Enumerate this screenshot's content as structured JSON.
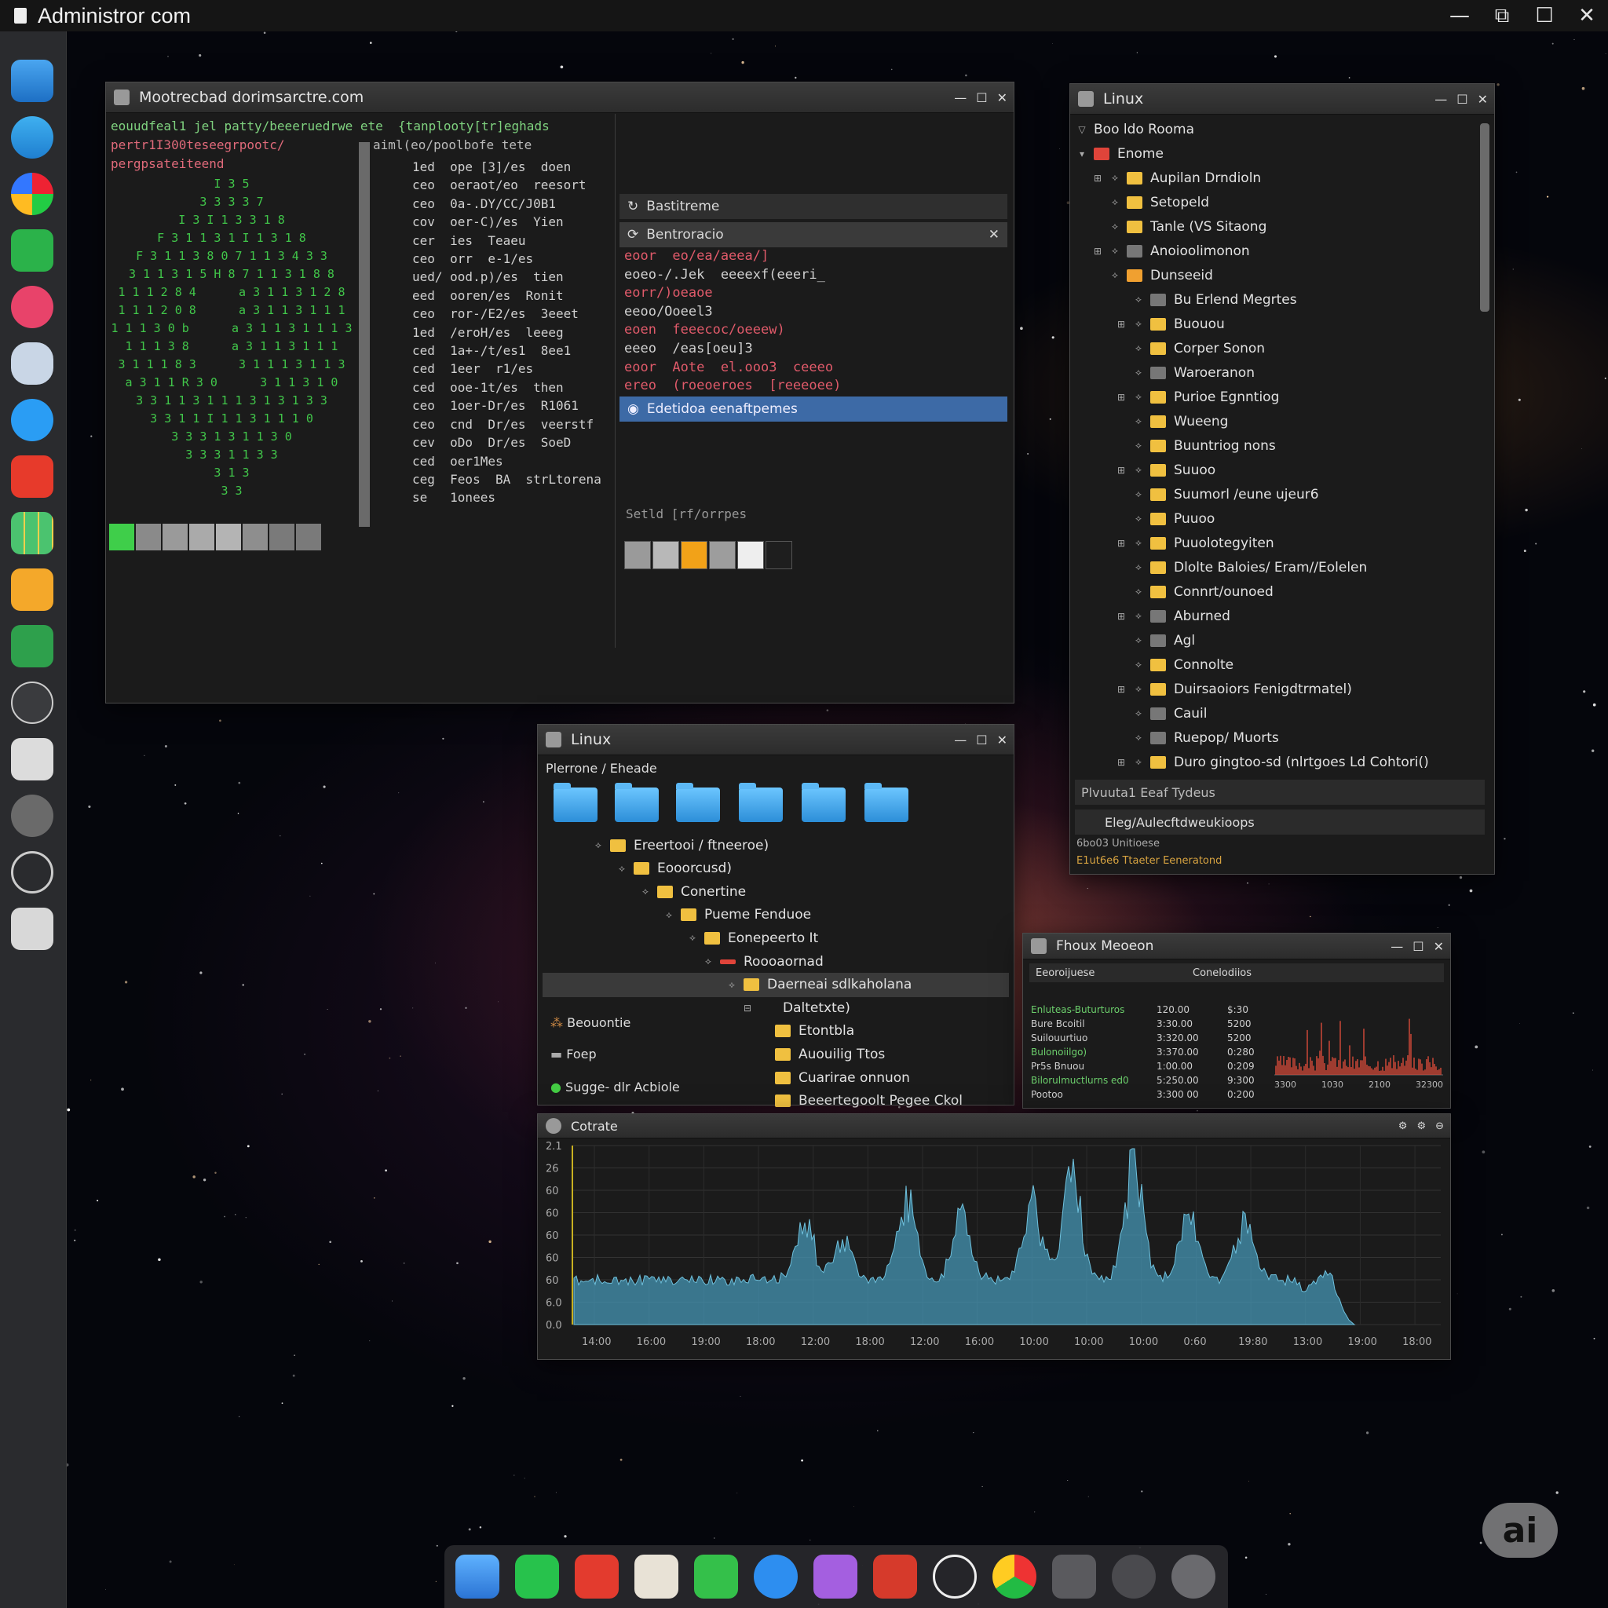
{
  "app": {
    "title": "Administror com"
  },
  "window_controls": {
    "minimize": "—",
    "restore": "⧉",
    "maximize": "☐",
    "close": "✕"
  },
  "terminal": {
    "title": "Mootrecbad dorimsarctre.com",
    "header_line": "eouudfeal1 jel patty/beeeruedrwe ete  {tanplooty[tr]eghads",
    "line2": "pertr1I300teseegrpootc/",
    "line2b": "aiml(eo/poolbofe tete",
    "line3": "pergpsateiteend",
    "art": [
      "I 3 5",
      "3 3 3 3 7",
      "I 3 I 1 3 3 1 8",
      "F 3 1 1 3 1 I 1 3 1 8",
      "F 3 1 1 3 8 0 7 1 1 3 4 3 3",
      "3 1 1 3 1 5 H 8 7 1 1 3 1 8 8",
      "1 1 1 2 8 4      a 3 1 1 3 1 2 8",
      "1 1 1 2 0 8      a 3 1 1 3 1 1 1",
      "1 1 1 3 0 b      a 3 1 1 3 1 1 1 3",
      "1 1 1 3 8      a 3 1 1 3 1 1 1",
      "3 1 1 1 8 3      3 1 1 1 3 1 1 3",
      "a 3 1 1 R 3 0      3 1 1 3 1 0",
      "3 3 1 1 3 1 1 1 3 1 3 1 3 3",
      "3 3 1 1 I 1 1 3 1 1 1 0",
      "3 3 3 1 3 1 1 3 0",
      "3 3 3 1 1 3 3",
      "3 1 3",
      "3 3"
    ],
    "process_list": [
      "1ed  ope [3]/es  doen",
      "ceo  oeraot/eo  reesort",
      "ceo  0a-.DY/CC/J0B1",
      "cov  oer-C)/es  Yien",
      "cer  ies  Teaeu",
      "ceo  orr  e-1/es",
      "ued/ ood.p)/es  tien",
      "eed  ooren/es  Ronit",
      "ceo  ror-/E2/es  3eeet",
      "1ed  /eroH/es  leeeg",
      "ced  1a+-/t/es1  8ee1",
      "ced  1eer  r1/es",
      "ced  ooe-1t/es  then",
      "ceo  1oer-Dr/es  R1061",
      "ceo  cnd  Dr/es  veerstf",
      "cev  oDo  Dr/es  SoeD",
      "ced  oer1Mes",
      "ceg  Feos  BA  strLtorena",
      "se   1onees"
    ],
    "swatches_left": [
      "#3fce4a",
      "#8a8a8a",
      "#9a9a9a",
      "#aaaaaa",
      "#b4b4b4",
      "#8e8e8e",
      "#7a7a7a",
      "#7a7a7a"
    ],
    "manager": {
      "item1": "Bastitreme",
      "item2": "Bentroracio",
      "code": [
        "eoor  eo/ea/aeea/]",
        "eoeo-/.Jek  eeeexf(eeeri_",
        "eorr/)oeaoe",
        "eeoo/Ooeel3",
        "eoen  feeecoc/oeeew)",
        "eeeo  /eas[oeu]3",
        "eoor  Aote  el.ooo3  ceeeo",
        "ereo  (roeoeroes  [reeeoee)"
      ],
      "selected": "Edetidoa  eenaftpemes",
      "footer": "Setld  [rf/orrpes",
      "swatches": [
        "#9a9a9a",
        "#b8b8b8",
        "#f2a218",
        "#9d9d9d",
        "#eeeeee",
        "#1e1e1e"
      ]
    }
  },
  "linux_tree": {
    "title": "Linux",
    "root": "Boo ldo Rooma",
    "home": "Enome",
    "items": [
      {
        "label": "Aupilan Drndioln",
        "color": "#f0c040"
      },
      {
        "label": "Setopeld",
        "color": "#f0c040"
      },
      {
        "label": "Tanle (VS Sitaong",
        "color": "#f0c040"
      },
      {
        "label": "Anoioolimonon",
        "color": "#777"
      },
      {
        "label": "Dunseeid",
        "color": "#f0a030"
      },
      {
        "label": "Bu Erlend Megrtes",
        "color": "#777"
      },
      {
        "label": "Buouou",
        "color": "#f0c040"
      },
      {
        "label": "Corper Sonon",
        "color": "#f0c040"
      },
      {
        "label": "Waroeranon",
        "color": "#777"
      },
      {
        "label": "Purioe Egnntiog",
        "color": "#f0c040"
      },
      {
        "label": "Wueeng",
        "color": "#f0c040"
      },
      {
        "label": "Buuntriog nons",
        "color": "#f0c040"
      },
      {
        "label": "Suuoo",
        "color": "#f0c040"
      },
      {
        "label": "Suumorl /eune ujeur6",
        "color": "#f0c040"
      },
      {
        "label": "Puuoo",
        "color": "#f0c040"
      },
      {
        "label": "Puuolotegyiten",
        "color": "#f0c040"
      },
      {
        "label": "Dlolte Baloies/ Eram//Eolelen",
        "color": "#f0c040"
      },
      {
        "label": "Connrt/ounoed",
        "color": "#f0c040"
      },
      {
        "label": "Aburned",
        "color": "#777"
      },
      {
        "label": "Agl",
        "color": "#777"
      },
      {
        "label": "Connolte",
        "color": "#f0c040"
      },
      {
        "label": "Duirsaoiors Fenigdtrmatel)",
        "color": "#f0c040"
      },
      {
        "label": "Cauil",
        "color": "#777"
      },
      {
        "label": "Ruepop/ Muorts",
        "color": "#777"
      },
      {
        "label": "Duro gingtoo-sd (nlrtgoes Ld Cohtori()",
        "color": "#f0c040"
      }
    ],
    "footer1": "Plvuuta1  Eeaf  Tydeus",
    "footer2": "Eleg/Aulecftdweukioops",
    "status1": "6bo03   Unitioese",
    "status2": "E1ut6e6  Ttaeter  Eeneratond"
  },
  "files": {
    "title": "Linux",
    "breadcrumb": "Plerrone / Eheade",
    "tree": [
      "Ereertooi / ftneeroe)",
      "Eooorcusd)",
      "Conertine",
      "Pueme Fenduoe",
      "Eonepeerto It",
      "Roooaornad",
      "Daerneai sdlkaholana",
      "Daltetxte)",
      "Etontbla",
      "Auouilig Ttos",
      "Cuarirae onnuon",
      "Beeertegoolt Pegee Ckol"
    ],
    "left": [
      "Beouontie",
      "Foep",
      "Sugge- dlr Acbiole"
    ]
  },
  "proc": {
    "title": "Fhoux Meoeon",
    "tab1": "Eeoroijuese",
    "tab2": "Conelodiios",
    "rows": [
      [
        "Enluteas-Buturturos",
        "120.00",
        "$:30"
      ],
      [
        "Bure Bcoitil",
        "3:30.00",
        "5200"
      ],
      [
        "Suilouurtiuo",
        "3:320.00",
        "5200"
      ],
      [
        "Bulonoiilgo)",
        "3:370.00",
        "0:280"
      ],
      [
        "Pr5s  Bnuou",
        "1:00.00",
        "0:209"
      ],
      [
        "Bilorulmuctlurns  ed0",
        "5:250.00",
        "9:300"
      ],
      [
        "Pootoo",
        "3:300  00",
        "0:200"
      ]
    ],
    "xticks": [
      "3300",
      "1030",
      "2100",
      "32300"
    ]
  },
  "perf": {
    "title": "Cotrate",
    "yticks": [
      "2.1",
      "26",
      "60",
      "60",
      "60",
      "60",
      "60",
      "6.0",
      "0.0"
    ],
    "xticks": [
      "14:00",
      "16:00",
      "19:00",
      "18:00",
      "12:00",
      "18:00",
      "12:00",
      "16:00",
      "10:00",
      "10:00",
      "10:00",
      "0:60",
      "19:80",
      "13:00",
      "19:00",
      "18:00"
    ]
  },
  "badge": {
    "text": "ai"
  }
}
